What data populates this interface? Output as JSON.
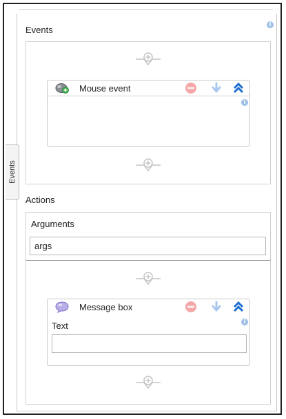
{
  "events": {
    "heading": "Events",
    "side_tab_label": "Events",
    "card": {
      "title": "Mouse event"
    }
  },
  "actions": {
    "heading": "Actions",
    "arguments": {
      "label": "Arguments",
      "value": "args"
    },
    "card": {
      "title": "Message box",
      "field_label": "Text",
      "field_value": ""
    }
  },
  "icons": {
    "info": "info-icon",
    "drop_target": "add-drop-target-icon",
    "mouse_event": "mouse-event-icon",
    "message_box": "message-box-icon",
    "stop": "stop-icon",
    "move_down": "arrow-down-icon",
    "collapse": "double-chevron-up-icon"
  },
  "colors": {
    "stop": "#f2a0a0",
    "move_down": "#a8c8ee",
    "collapse": "#1f6fd1",
    "info": "#9fbfe6"
  }
}
